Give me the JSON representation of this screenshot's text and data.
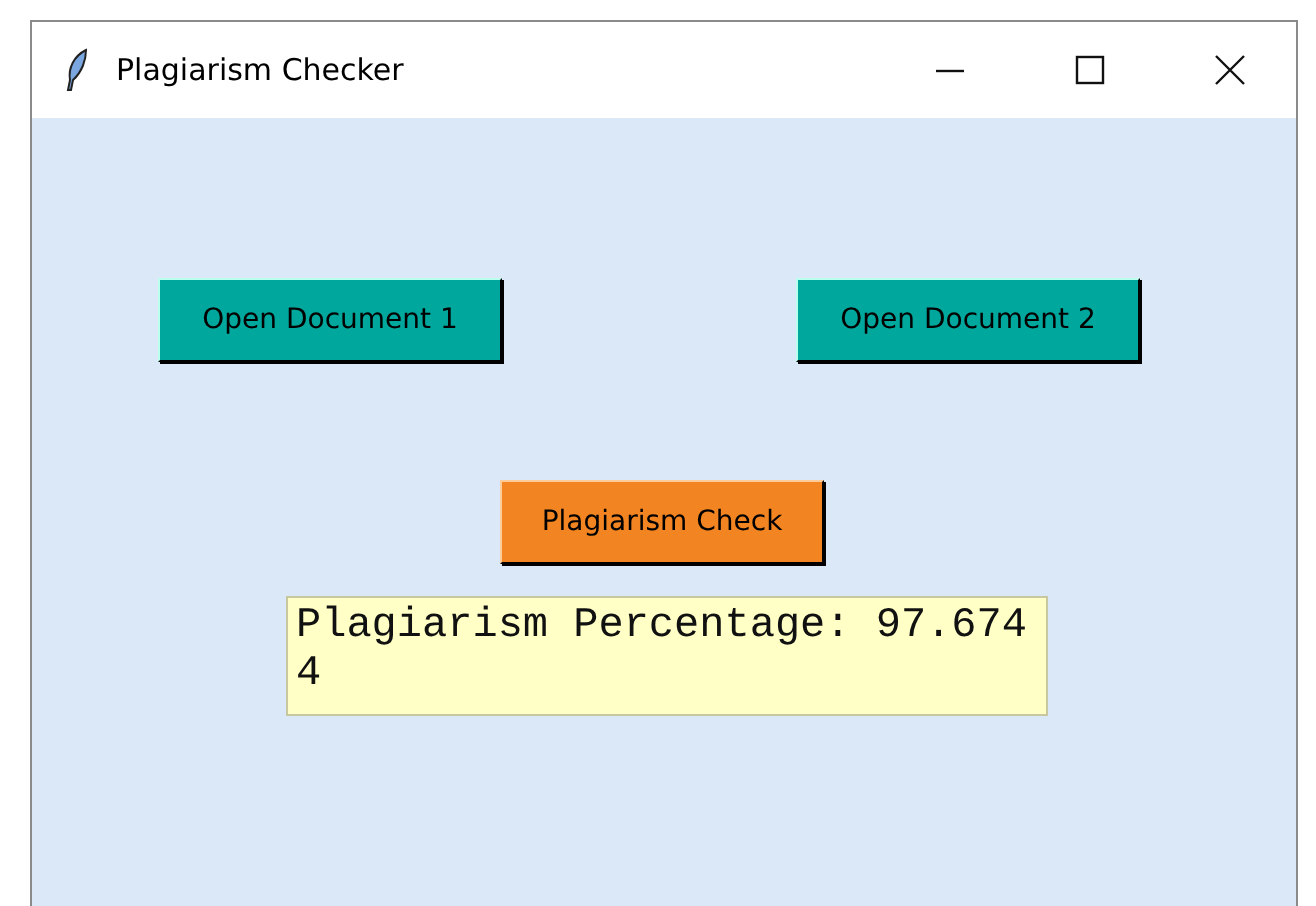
{
  "window": {
    "title": "Plagiarism Checker"
  },
  "buttons": [
    {
      "label": "Open Document 1",
      "kind": "open"
    },
    {
      "label": "Open Document 2",
      "kind": "open"
    },
    {
      "label": "Plagiarism Check",
      "kind": "check"
    }
  ],
  "result": {
    "text": "Plagiarism Percentage: 97.6744"
  }
}
